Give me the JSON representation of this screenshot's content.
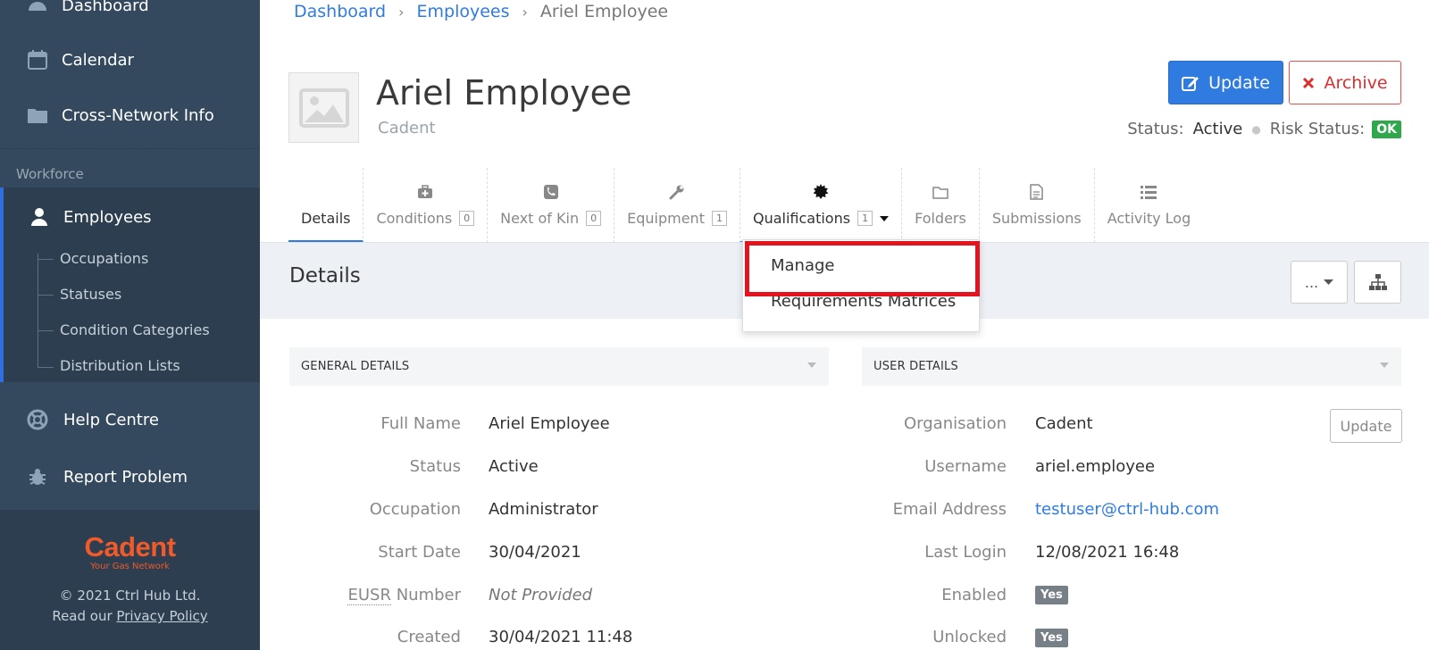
{
  "sidebar": {
    "items_top": [
      {
        "label": "Dashboard",
        "icon": "dashboard-icon"
      },
      {
        "label": "Calendar",
        "icon": "calendar-icon"
      },
      {
        "label": "Cross-Network Info",
        "icon": "folder-icon"
      }
    ],
    "section_label": "Workforce",
    "active_item": {
      "label": "Employees",
      "icon": "user-icon"
    },
    "sub_items": [
      "Occupations",
      "Statuses",
      "Condition Categories",
      "Distribution Lists"
    ],
    "items_bottom": [
      {
        "label": "Help Centre",
        "icon": "lifebuoy-icon"
      },
      {
        "label": "Report Problem",
        "icon": "bug-icon"
      }
    ],
    "footer": {
      "brand": "Cadent",
      "brand_tagline": "Your Gas Network",
      "copyright": "© 2021 Ctrl Hub Ltd.",
      "read_our": "Read our",
      "privacy_link": "Privacy Policy"
    }
  },
  "breadcrumb": [
    "Dashboard",
    "Employees",
    "Ariel Employee"
  ],
  "employee": {
    "name": "Ariel Employee",
    "organisation": "Cadent",
    "status_label": "Status:",
    "status": "Active",
    "risk_label": "Risk Status:",
    "risk": "OK"
  },
  "actions": {
    "update": "Update",
    "archive": "Archive"
  },
  "tabs": [
    {
      "label": "Details",
      "icon": "",
      "count": ""
    },
    {
      "label": "Conditions",
      "icon": "medkit-icon",
      "count": "0"
    },
    {
      "label": "Next of Kin",
      "icon": "phone-icon",
      "count": "0"
    },
    {
      "label": "Equipment",
      "icon": "wrench-icon",
      "count": "1"
    },
    {
      "label": "Qualifications",
      "icon": "certificate-icon",
      "count": "1"
    },
    {
      "label": "Folders",
      "icon": "folder-outline-icon",
      "count": ""
    },
    {
      "label": "Submissions",
      "icon": "file-icon",
      "count": ""
    },
    {
      "label": "Activity Log",
      "icon": "list-icon",
      "count": ""
    }
  ],
  "dropdown": {
    "items": [
      "Manage",
      "Requirements Matrices"
    ]
  },
  "details": {
    "title": "Details",
    "more_label": "...",
    "general": {
      "header": "GENERAL DETAILS",
      "rows": [
        {
          "label": "Full Name",
          "value": "Ariel Employee"
        },
        {
          "label": "Status",
          "value": "Active"
        },
        {
          "label": "Occupation",
          "value": "Administrator"
        },
        {
          "label": "Start Date",
          "value": "30/04/2021"
        },
        {
          "label_abbr": "EUSR",
          "label_rest": " Number",
          "value": "Not Provided"
        },
        {
          "label": "Created",
          "value": "30/04/2021 11:48"
        }
      ]
    },
    "user": {
      "header": "USER DETAILS",
      "update": "Update",
      "rows": [
        {
          "label": "Organisation",
          "value": "Cadent"
        },
        {
          "label": "Username",
          "value": "ariel.employee"
        },
        {
          "label": "Email Address",
          "value": "testuser@ctrl-hub.com"
        },
        {
          "label": "Last Login",
          "value": "12/08/2021 16:48"
        },
        {
          "label": "Enabled",
          "value": "Yes"
        },
        {
          "label": "Unlocked",
          "value": "Yes"
        }
      ]
    }
  },
  "colors": {
    "primary": "#2f7be0",
    "danger": "#d9302f",
    "success": "#2ea84a",
    "sidebar": "#34495e",
    "brand": "#f15a29",
    "highlight": "#e3141f"
  }
}
